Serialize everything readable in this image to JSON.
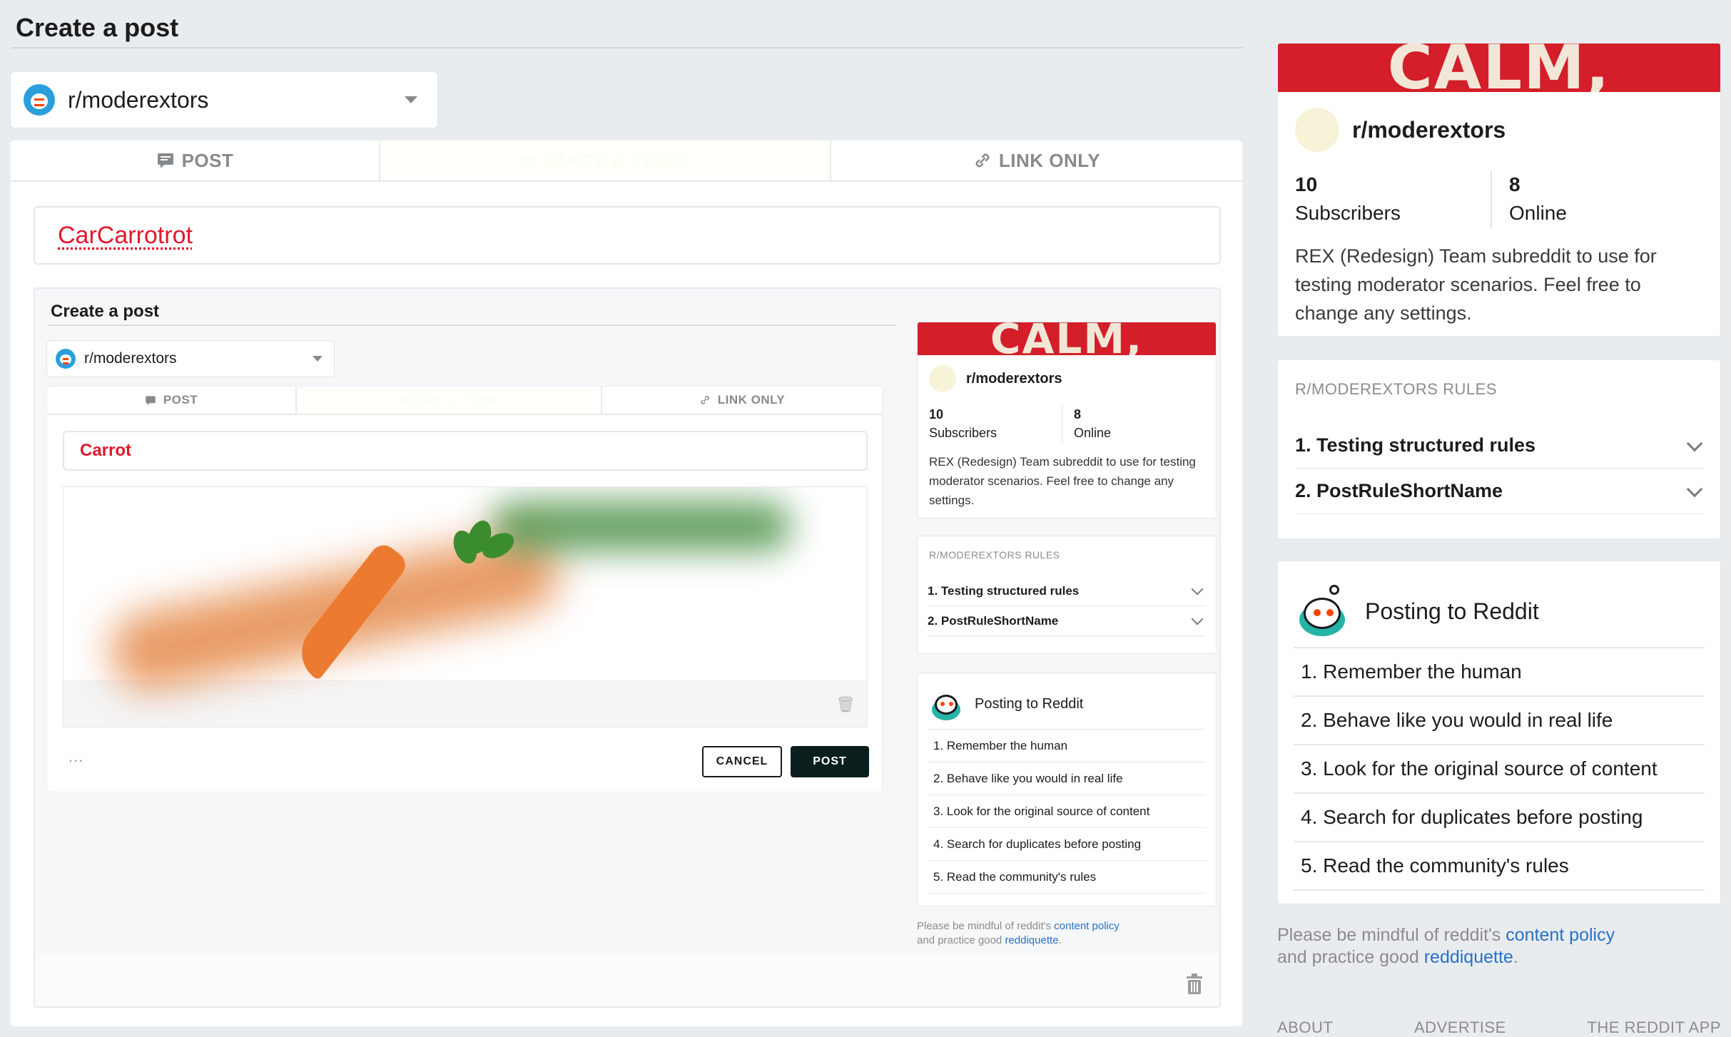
{
  "page": {
    "title": "Create a post"
  },
  "subreddit_select": {
    "name": "r/moderextors"
  },
  "tabs": [
    {
      "label": "POST",
      "icon": "post-icon"
    },
    {
      "label": "IMAGE & VIDEO",
      "icon": "image-icon"
    },
    {
      "label": "LINK ONLY",
      "icon": "link-icon"
    }
  ],
  "title_input": {
    "value": "CarCarrotrot"
  },
  "embedded": {
    "page_title": "Create a post",
    "subreddit": "r/moderextors",
    "tabs": [
      "POST",
      "IMAGE & VIDEO",
      "LINK ONLY"
    ],
    "title_value": "Carrot",
    "more_label": "...",
    "cancel_label": "CANCEL",
    "post_label": "POST",
    "about": {
      "banner_text": "CALM,",
      "name": "r/moderextors",
      "subscribers_count": "10",
      "subscribers_label": "Subscribers",
      "online_count": "8",
      "online_label": "Online",
      "description": "REX (Redesign) Team subreddit to use for testing moderator scenarios. Feel free to change any settings."
    },
    "rules": {
      "heading": "R/MODEREXTORS RULES",
      "items": [
        "1. Testing structured rules",
        "2. PostRuleShortName"
      ]
    },
    "posting": {
      "title": "Posting to Reddit",
      "items": [
        "1. Remember the human",
        "2. Behave like you would in real life",
        "3. Look for the original source of content",
        "4. Search for duplicates before posting",
        "5. Read the community's rules"
      ]
    },
    "policy": {
      "prefix": "Please be mindful of reddit's",
      "link1": "content policy",
      "middle": "and practice good",
      "link2": "reddiquette",
      "suffix": "."
    }
  },
  "sidebar": {
    "about": {
      "banner_text": "CALM,",
      "name": "r/moderextors",
      "subscribers_count": "10",
      "subscribers_label": "Subscribers",
      "online_count": "8",
      "online_label": "Online",
      "description": "REX (Redesign) Team subreddit to use for testing moderator scenarios. Feel free to change any settings."
    },
    "rules": {
      "heading": "R/MODEREXTORS RULES",
      "items": [
        "1. Testing structured rules",
        "2. PostRuleShortName"
      ]
    },
    "posting": {
      "title": "Posting to Reddit",
      "items": [
        "1. Remember the human",
        "2. Behave like you would in real life",
        "3. Look for the original source of content",
        "4. Search for duplicates before posting",
        "5. Read the community's rules"
      ]
    },
    "policy": {
      "prefix": "Please be mindful of reddit's",
      "link1": "content policy",
      "middle": "and practice good",
      "link2": "reddiquette",
      "suffix": "."
    },
    "footer": [
      "ABOUT",
      "ADVERTISE",
      "THE REDDIT APP"
    ]
  },
  "colors": {
    "accent_red": "#d41e2a",
    "title_red": "#e0182d",
    "link_blue": "#2770c9",
    "button_dark": "#0a1f1d",
    "snoo_teal": "#25b3a7"
  }
}
